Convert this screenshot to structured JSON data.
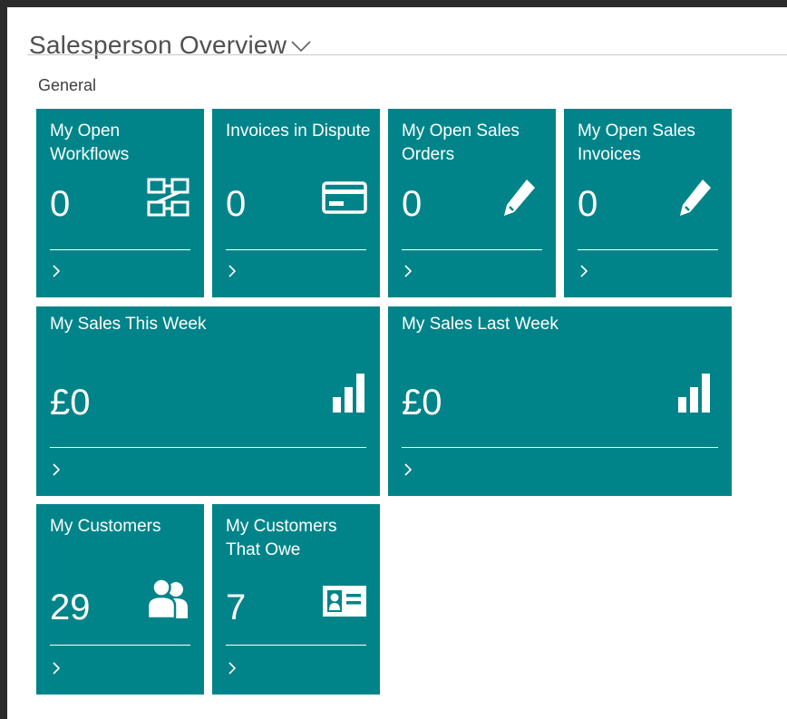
{
  "page": {
    "title": "Salesperson Overview",
    "section": "General"
  },
  "tiles": [
    {
      "title": "My Open Workflows",
      "value": "0",
      "icon": "workflow-icon"
    },
    {
      "title": "Invoices in Dispute",
      "value": "0",
      "icon": "credit-card-icon"
    },
    {
      "title": "My Open Sales Orders",
      "value": "0",
      "icon": "pencil-icon"
    },
    {
      "title": "My Open Sales Invoices",
      "value": "0",
      "icon": "pencil-icon"
    },
    {
      "title": "My Sales This Week",
      "value": "£0",
      "icon": "bar-chart-icon"
    },
    {
      "title": "My Sales Last Week",
      "value": "£0",
      "icon": "bar-chart-icon"
    },
    {
      "title": "My Customers",
      "value": "29",
      "icon": "people-icon"
    },
    {
      "title": "My Customers That Owe",
      "value": "7",
      "icon": "id-card-icon"
    }
  ],
  "colors": {
    "tile": "#008489",
    "background": "#ffffff",
    "frame": "#2b2b2b"
  }
}
